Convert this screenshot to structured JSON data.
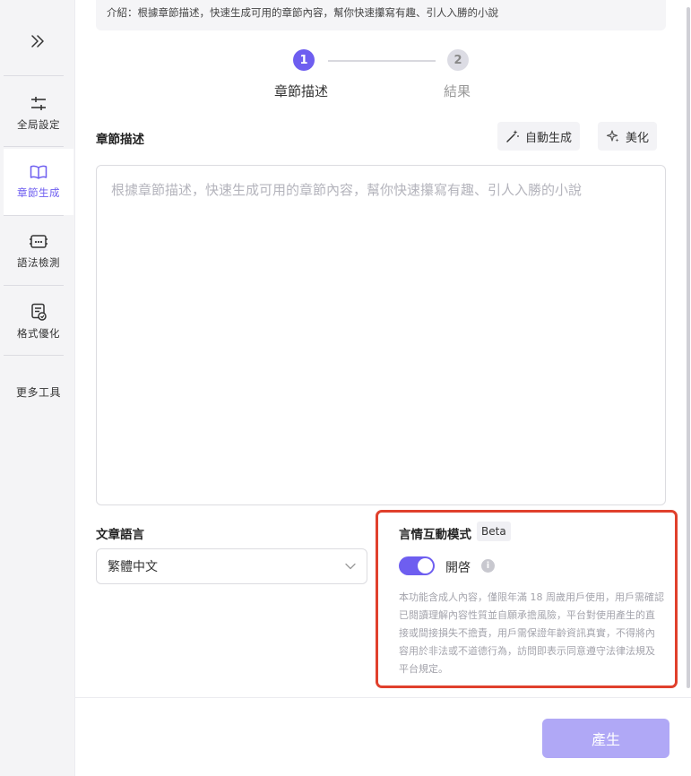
{
  "intro": {
    "text": "介紹：根據章節描述，快速生成可用的章節內容，幫你快速攥寫有趣、引人入勝的小說"
  },
  "sidebar": {
    "items": [
      {
        "label": "全局設定",
        "icon": "sliders-icon"
      },
      {
        "label": "章節生成",
        "icon": "book-icon"
      },
      {
        "label": "語法檢測",
        "icon": "grammar-check-icon"
      },
      {
        "label": "格式優化",
        "icon": "format-optimize-icon"
      },
      {
        "label": "更多工具",
        "icon": ""
      }
    ],
    "active_index": 1
  },
  "steps": [
    {
      "number": "1",
      "label": "章節描述"
    },
    {
      "number": "2",
      "label": "結果"
    }
  ],
  "chapter": {
    "title": "章節描述",
    "auto_generate_label": "自動生成",
    "beautify_label": "美化",
    "placeholder": "根據章節描述，快速生成可用的章節內容，幫你快速攥寫有趣、引人入勝的小說"
  },
  "language": {
    "title": "文章語言",
    "value": "繁體中文"
  },
  "romance_mode": {
    "title": "言情互動模式",
    "badge": "Beta",
    "toggle_label": "開啓",
    "enabled": true,
    "disclaimer": "本功能含成人內容，僅限年滿 18 周歲用戶使用，用戶需確認已閱讀理解內容性質並自願承擔風險，平台對使用產生的直接或間接損失不擔責，用戶需保證年齡資訊真實，不得將內容用於非法或不道德行為，訪問即表示同意遵守法律法規及平台規定。"
  },
  "footer": {
    "generate_label": "產生"
  },
  "colors": {
    "accent": "#6e5ef0",
    "accent_disabled": "#b0a8f6",
    "highlight": "#e0402c"
  }
}
